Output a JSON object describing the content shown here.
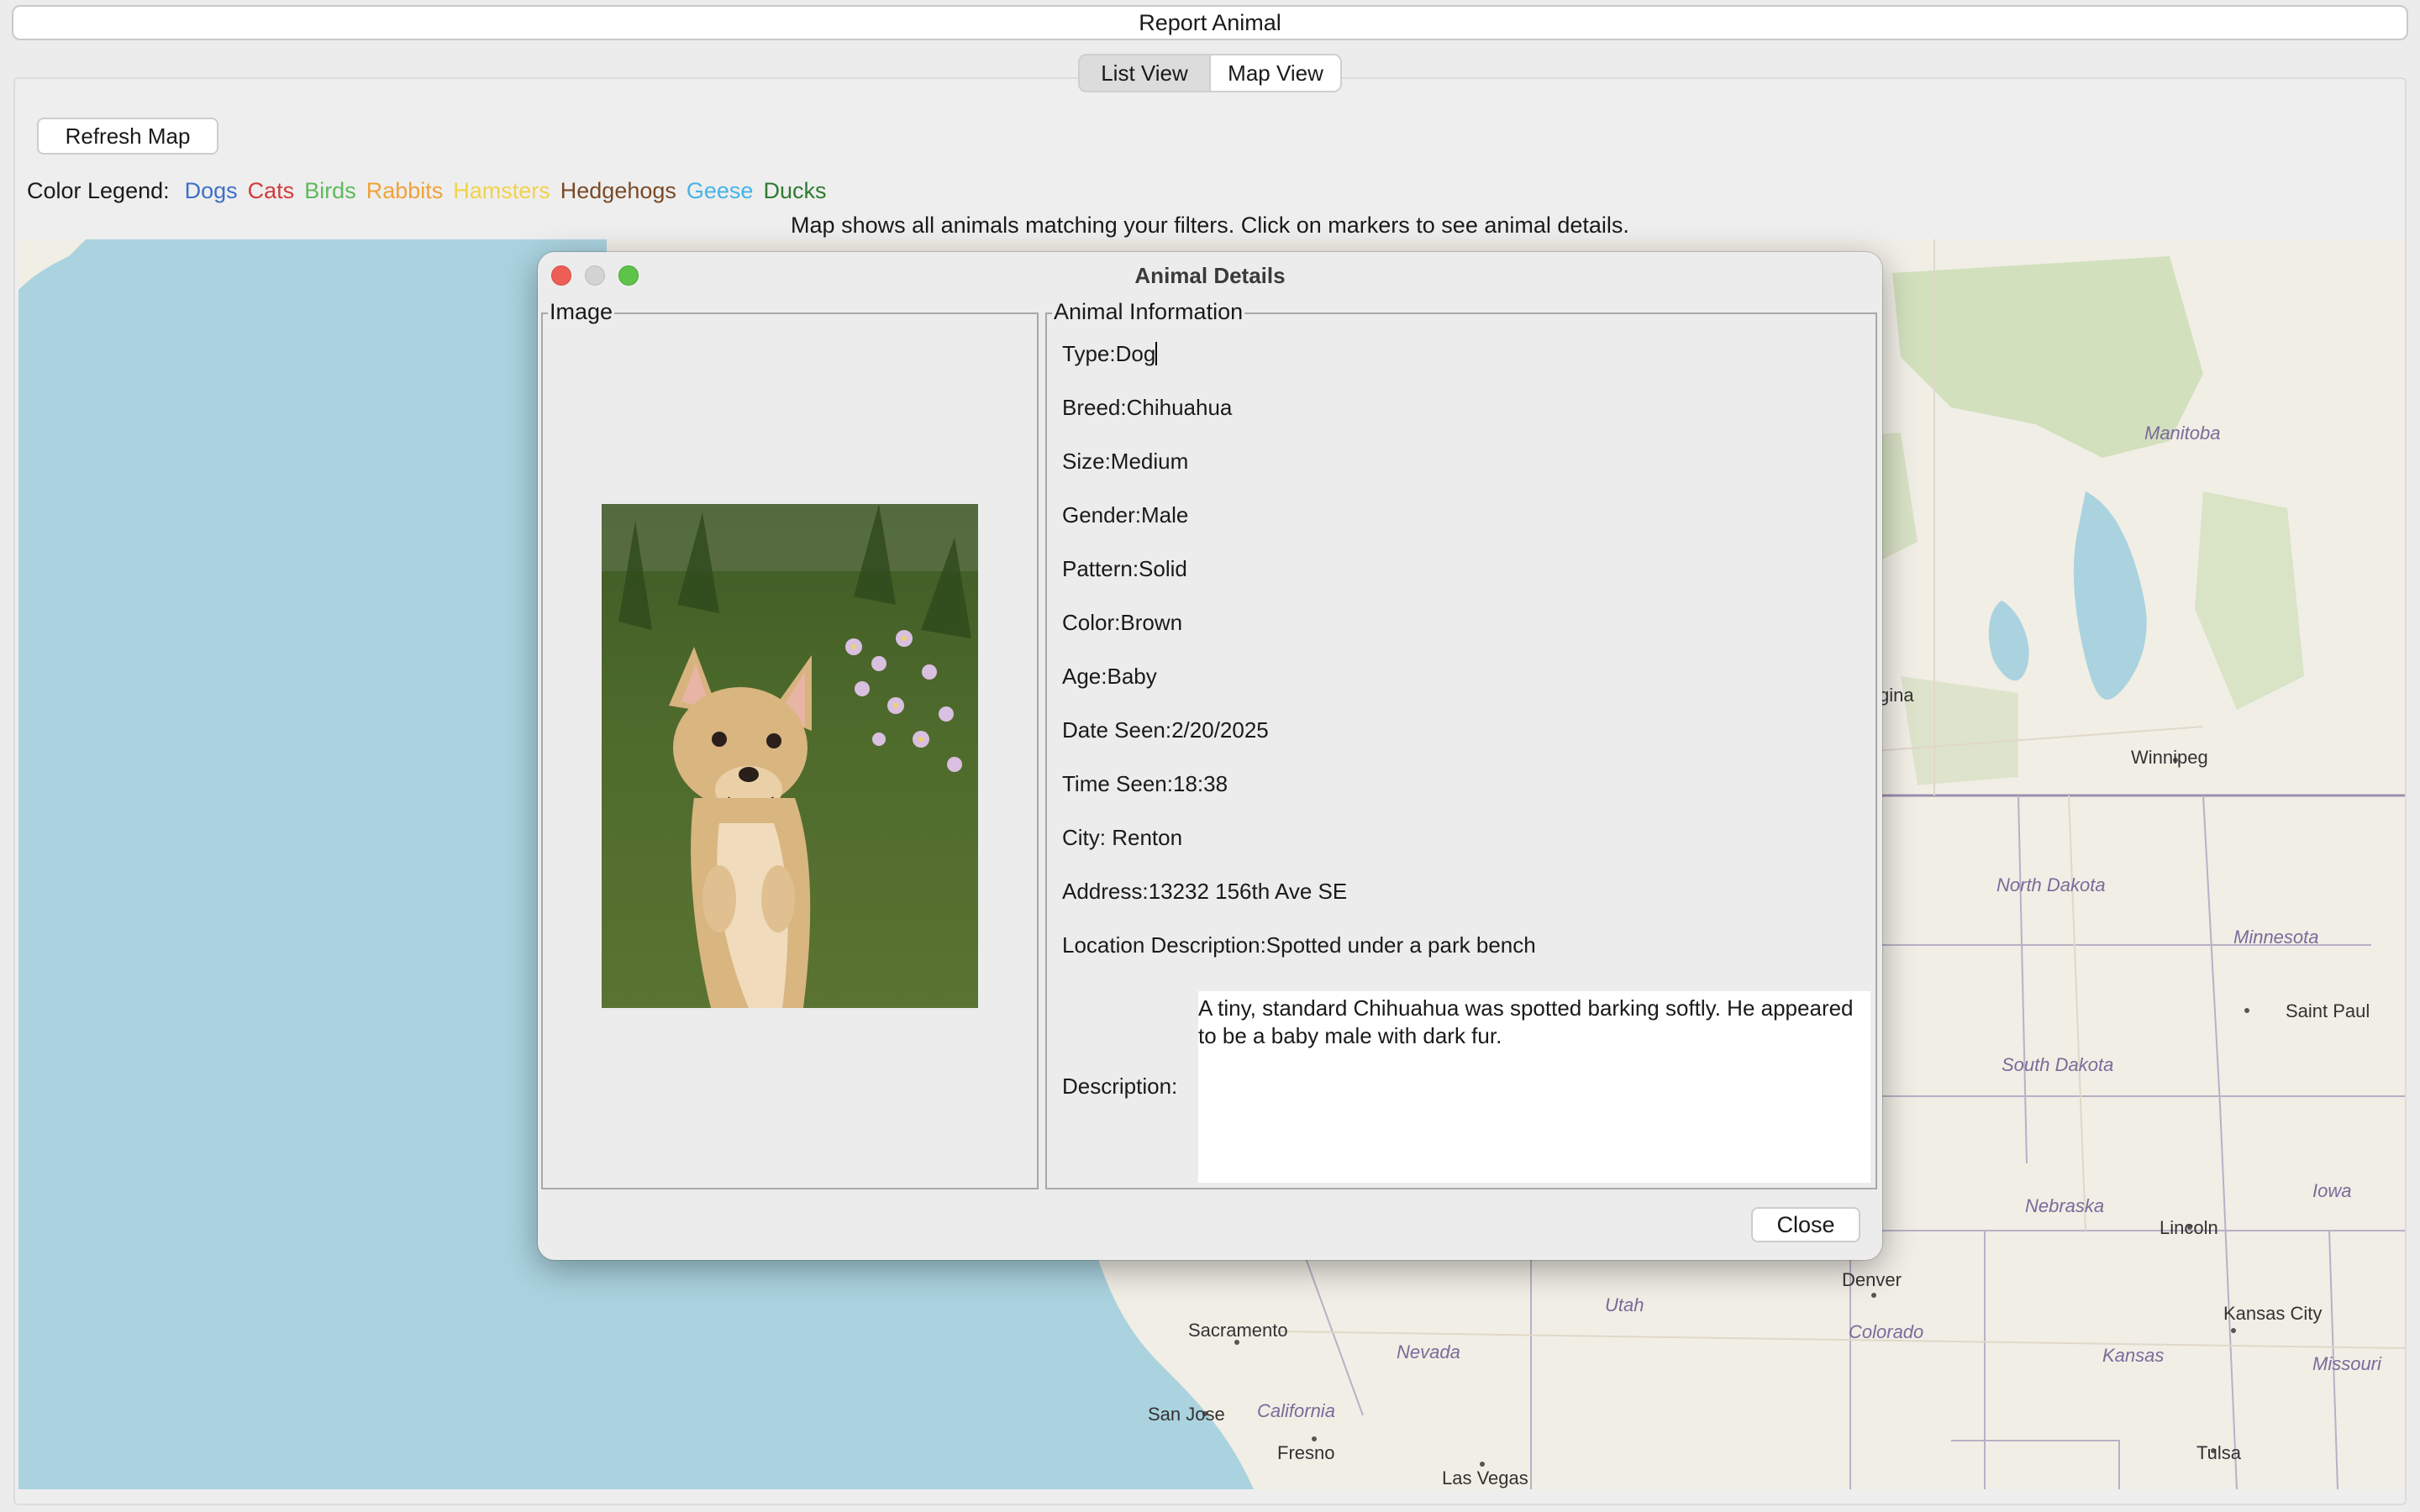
{
  "top_bar": {
    "report_label": "Report Animal"
  },
  "tabs": [
    {
      "label": "List View",
      "selected": false
    },
    {
      "label": "Map View",
      "selected": true
    }
  ],
  "map_panel": {
    "refresh_label": "Refresh Map",
    "legend_title": "Color Legend:",
    "legend": [
      {
        "label": "Dogs",
        "color": "#3f6fc7"
      },
      {
        "label": "Cats",
        "color": "#d03b3b"
      },
      {
        "label": "Birds",
        "color": "#5dbb5a"
      },
      {
        "label": "Rabbits",
        "color": "#f0a23a"
      },
      {
        "label": "Hamsters",
        "color": "#f2d24a"
      },
      {
        "label": "Hedgehogs",
        "color": "#7a4a25"
      },
      {
        "label": "Geese",
        "color": "#45b4e6"
      },
      {
        "label": "Ducks",
        "color": "#2f7a2f"
      }
    ],
    "info_text": "Map shows all animals matching your filters. Click on markers to see animal details.",
    "map_labels": {
      "manitoba": "Manitoba",
      "regina": "gina",
      "winnipeg": "Winnipeg",
      "north_dakota": "North Dakota",
      "minnesota": "Minnesota",
      "saint_paul": "Saint Paul",
      "south_dakota": "South Dakota",
      "iowa": "Iowa",
      "nebraska": "Nebraska",
      "lincoln": "Lincoln",
      "denver": "Denver",
      "utah": "Utah",
      "colorado": "Colorado",
      "kansas_city": "Kansas City",
      "kansas": "Kansas",
      "missouri": "Missouri",
      "sacramento": "Sacramento",
      "nevada": "Nevada",
      "california": "California",
      "san_jose": "San Jose",
      "fresno": "Fresno",
      "las_vegas": "Las Vegas",
      "tulsa": "Tulsa"
    }
  },
  "dialog": {
    "title": "Animal Details",
    "image_group_title": "Image",
    "info_group_title": "Animal Information",
    "fields": {
      "type": "Type:Dog",
      "breed": "Breed:Chihuahua",
      "size": "Size:Medium",
      "gender": "Gender:Male",
      "pattern": "Pattern:Solid",
      "color": "Color:Brown",
      "age": "Age:Baby",
      "date_seen": "Date Seen:2/20/2025",
      "time_seen": "Time Seen:18:38",
      "city": "City: Renton",
      "address": "Address:13232 156th Ave SE",
      "location_description": "Location Description:Spotted under a park bench"
    },
    "description_label": "Description:",
    "description_text": "A tiny, standard Chihuahua was spotted barking softly. He appeared to be a baby male with dark fur.",
    "close_label": "Close"
  }
}
